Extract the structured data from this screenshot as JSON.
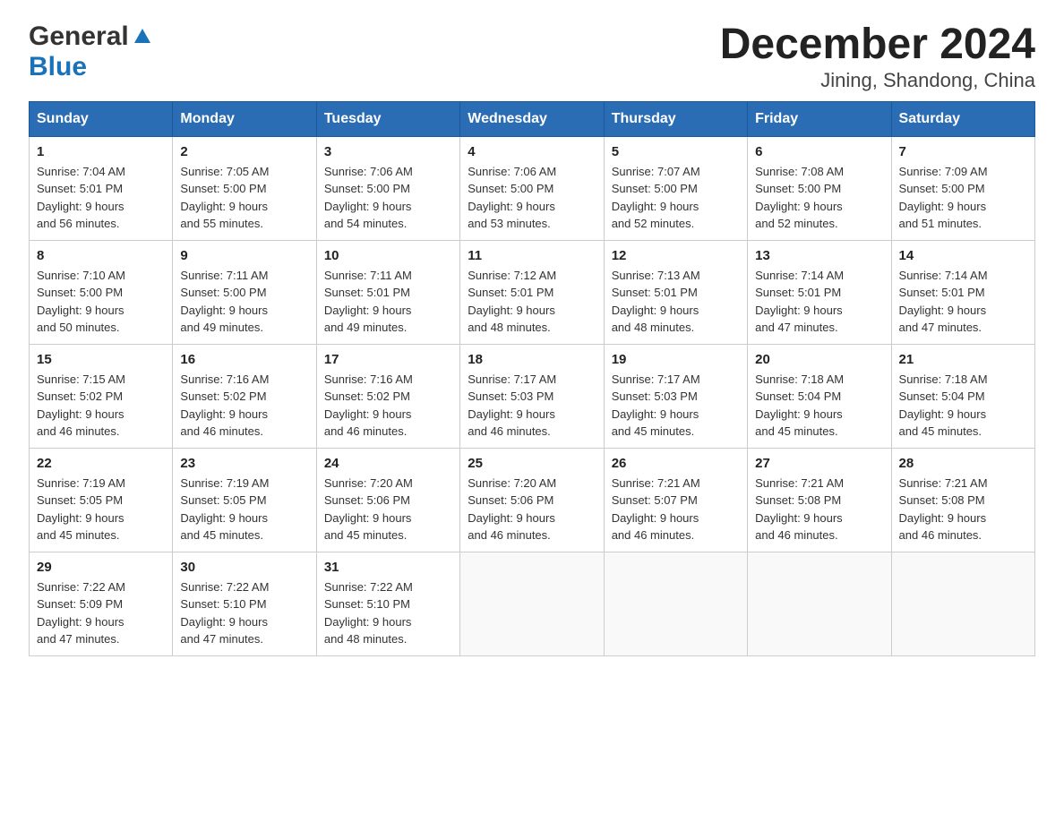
{
  "header": {
    "title": "December 2024",
    "subtitle": "Jining, Shandong, China",
    "logo_general": "General",
    "logo_blue": "Blue"
  },
  "days_of_week": [
    "Sunday",
    "Monday",
    "Tuesday",
    "Wednesday",
    "Thursday",
    "Friday",
    "Saturday"
  ],
  "weeks": [
    [
      {
        "day": "1",
        "sunrise": "7:04 AM",
        "sunset": "5:01 PM",
        "daylight": "9 hours and 56 minutes."
      },
      {
        "day": "2",
        "sunrise": "7:05 AM",
        "sunset": "5:00 PM",
        "daylight": "9 hours and 55 minutes."
      },
      {
        "day": "3",
        "sunrise": "7:06 AM",
        "sunset": "5:00 PM",
        "daylight": "9 hours and 54 minutes."
      },
      {
        "day": "4",
        "sunrise": "7:06 AM",
        "sunset": "5:00 PM",
        "daylight": "9 hours and 53 minutes."
      },
      {
        "day": "5",
        "sunrise": "7:07 AM",
        "sunset": "5:00 PM",
        "daylight": "9 hours and 52 minutes."
      },
      {
        "day": "6",
        "sunrise": "7:08 AM",
        "sunset": "5:00 PM",
        "daylight": "9 hours and 52 minutes."
      },
      {
        "day": "7",
        "sunrise": "7:09 AM",
        "sunset": "5:00 PM",
        "daylight": "9 hours and 51 minutes."
      }
    ],
    [
      {
        "day": "8",
        "sunrise": "7:10 AM",
        "sunset": "5:00 PM",
        "daylight": "9 hours and 50 minutes."
      },
      {
        "day": "9",
        "sunrise": "7:11 AM",
        "sunset": "5:00 PM",
        "daylight": "9 hours and 49 minutes."
      },
      {
        "day": "10",
        "sunrise": "7:11 AM",
        "sunset": "5:01 PM",
        "daylight": "9 hours and 49 minutes."
      },
      {
        "day": "11",
        "sunrise": "7:12 AM",
        "sunset": "5:01 PM",
        "daylight": "9 hours and 48 minutes."
      },
      {
        "day": "12",
        "sunrise": "7:13 AM",
        "sunset": "5:01 PM",
        "daylight": "9 hours and 48 minutes."
      },
      {
        "day": "13",
        "sunrise": "7:14 AM",
        "sunset": "5:01 PM",
        "daylight": "9 hours and 47 minutes."
      },
      {
        "day": "14",
        "sunrise": "7:14 AM",
        "sunset": "5:01 PM",
        "daylight": "9 hours and 47 minutes."
      }
    ],
    [
      {
        "day": "15",
        "sunrise": "7:15 AM",
        "sunset": "5:02 PM",
        "daylight": "9 hours and 46 minutes."
      },
      {
        "day": "16",
        "sunrise": "7:16 AM",
        "sunset": "5:02 PM",
        "daylight": "9 hours and 46 minutes."
      },
      {
        "day": "17",
        "sunrise": "7:16 AM",
        "sunset": "5:02 PM",
        "daylight": "9 hours and 46 minutes."
      },
      {
        "day": "18",
        "sunrise": "7:17 AM",
        "sunset": "5:03 PM",
        "daylight": "9 hours and 46 minutes."
      },
      {
        "day": "19",
        "sunrise": "7:17 AM",
        "sunset": "5:03 PM",
        "daylight": "9 hours and 45 minutes."
      },
      {
        "day": "20",
        "sunrise": "7:18 AM",
        "sunset": "5:04 PM",
        "daylight": "9 hours and 45 minutes."
      },
      {
        "day": "21",
        "sunrise": "7:18 AM",
        "sunset": "5:04 PM",
        "daylight": "9 hours and 45 minutes."
      }
    ],
    [
      {
        "day": "22",
        "sunrise": "7:19 AM",
        "sunset": "5:05 PM",
        "daylight": "9 hours and 45 minutes."
      },
      {
        "day": "23",
        "sunrise": "7:19 AM",
        "sunset": "5:05 PM",
        "daylight": "9 hours and 45 minutes."
      },
      {
        "day": "24",
        "sunrise": "7:20 AM",
        "sunset": "5:06 PM",
        "daylight": "9 hours and 45 minutes."
      },
      {
        "day": "25",
        "sunrise": "7:20 AM",
        "sunset": "5:06 PM",
        "daylight": "9 hours and 46 minutes."
      },
      {
        "day": "26",
        "sunrise": "7:21 AM",
        "sunset": "5:07 PM",
        "daylight": "9 hours and 46 minutes."
      },
      {
        "day": "27",
        "sunrise": "7:21 AM",
        "sunset": "5:08 PM",
        "daylight": "9 hours and 46 minutes."
      },
      {
        "day": "28",
        "sunrise": "7:21 AM",
        "sunset": "5:08 PM",
        "daylight": "9 hours and 46 minutes."
      }
    ],
    [
      {
        "day": "29",
        "sunrise": "7:22 AM",
        "sunset": "5:09 PM",
        "daylight": "9 hours and 47 minutes."
      },
      {
        "day": "30",
        "sunrise": "7:22 AM",
        "sunset": "5:10 PM",
        "daylight": "9 hours and 47 minutes."
      },
      {
        "day": "31",
        "sunrise": "7:22 AM",
        "sunset": "5:10 PM",
        "daylight": "9 hours and 48 minutes."
      },
      null,
      null,
      null,
      null
    ]
  ],
  "labels": {
    "sunrise": "Sunrise:",
    "sunset": "Sunset:",
    "daylight": "Daylight:"
  }
}
